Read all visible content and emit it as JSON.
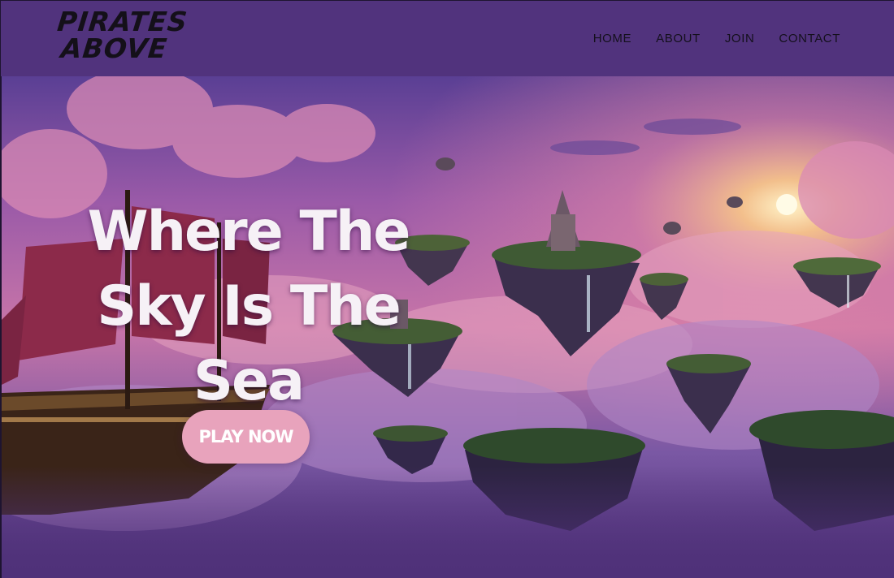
{
  "brand": {
    "line1": "PIRATES",
    "line2": "ABOVE"
  },
  "nav": {
    "items": [
      {
        "label": "HOME"
      },
      {
        "label": "ABOUT"
      },
      {
        "label": "JOIN"
      },
      {
        "label": "CONTACT"
      }
    ]
  },
  "hero": {
    "headline": "Where The Sky Is The Sea",
    "cta_label": "PLAY NOW"
  },
  "colors": {
    "nav_background": "#51337d",
    "cta_background": "#e8a3bc",
    "headline_text": "#f6f1f6"
  }
}
